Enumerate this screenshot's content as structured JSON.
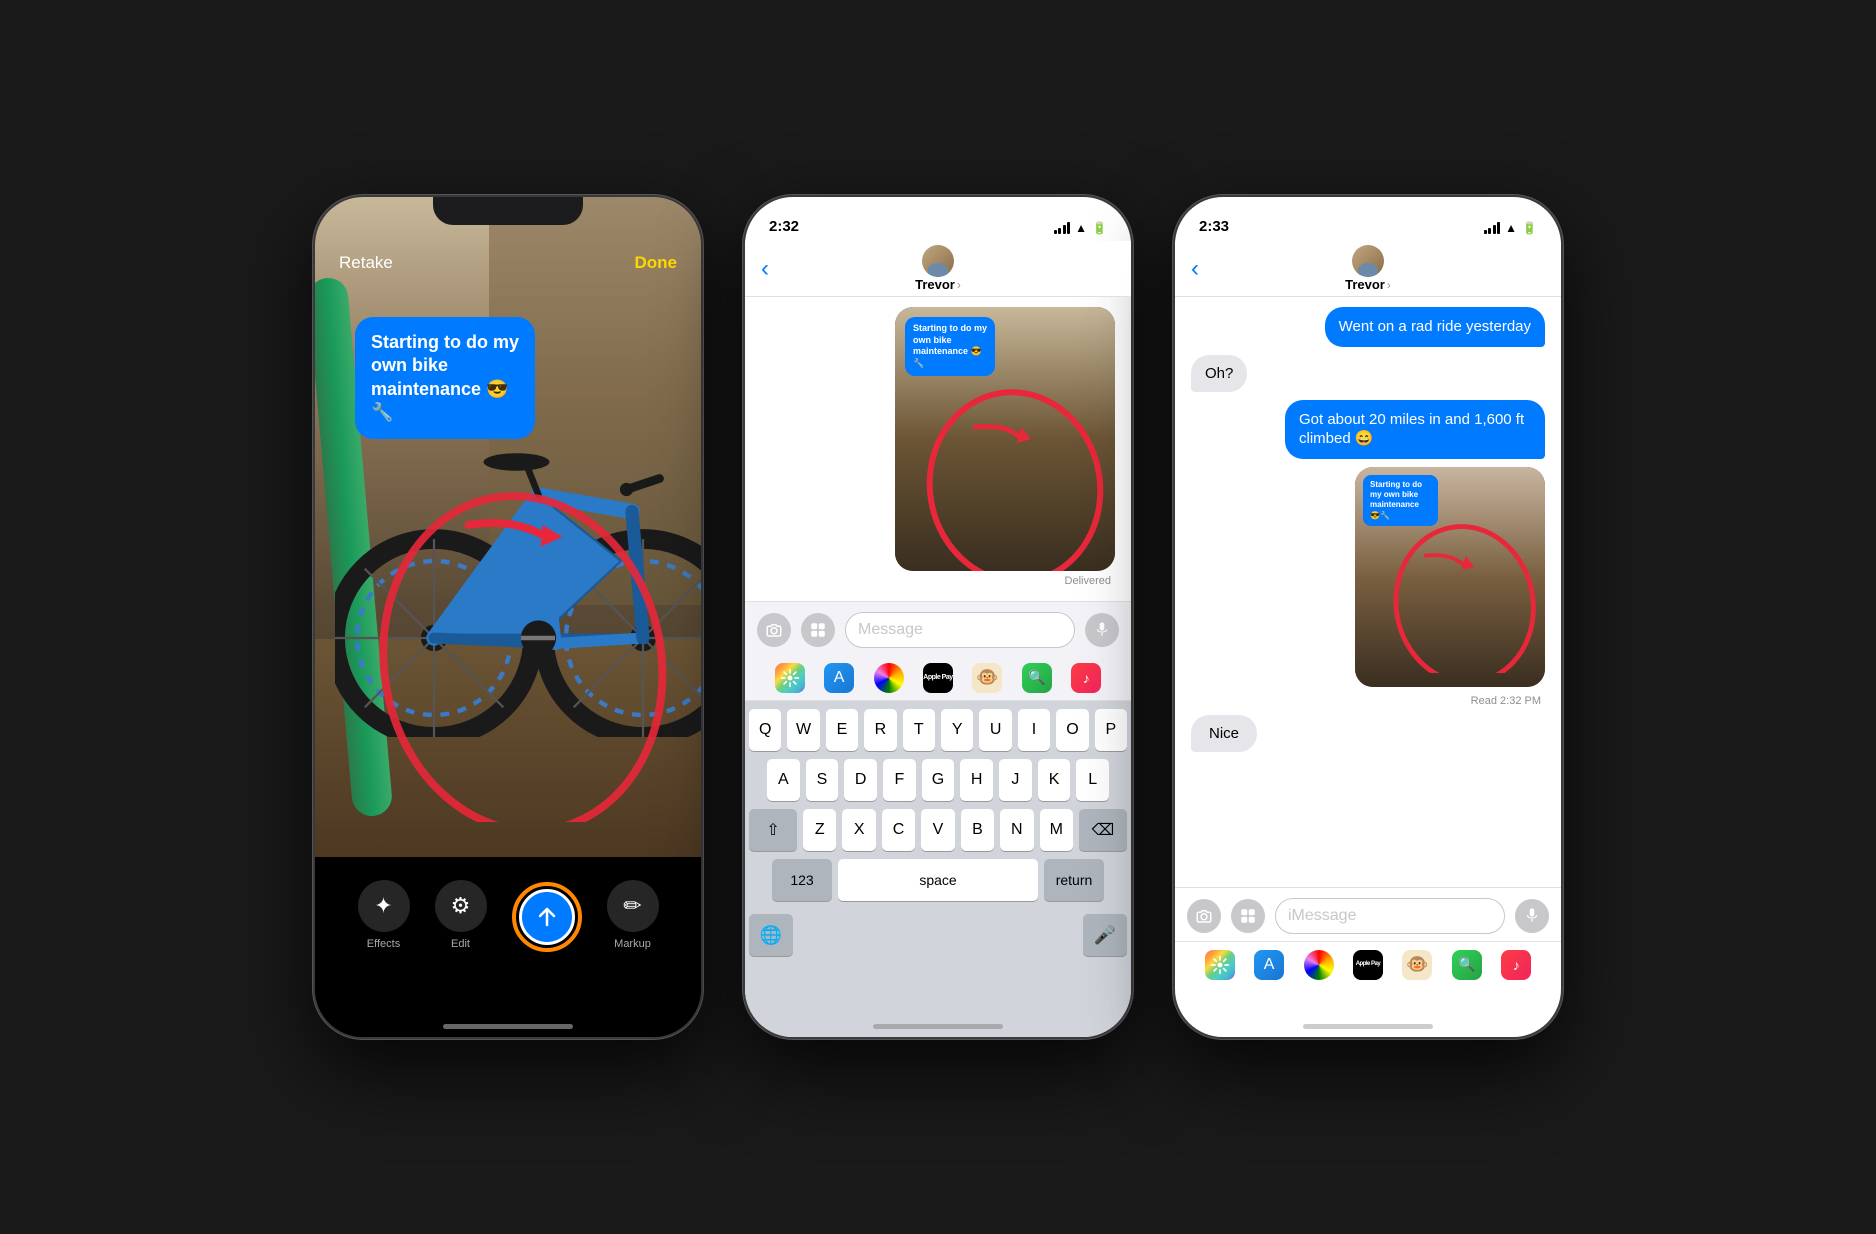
{
  "phones": [
    {
      "id": "phone1",
      "type": "camera_markup",
      "status_bar": {
        "time": "",
        "icons": []
      },
      "top_bar": {
        "left_label": "Retake",
        "right_label": "Done"
      },
      "photo_overlay_text": "Starting to do my own bike maintenance 😎🔧",
      "toolbar_icons": [
        {
          "icon": "✦",
          "label": "Effects"
        },
        {
          "icon": "⚙",
          "label": "Edit"
        },
        {
          "icon": "✏",
          "label": "Markup"
        }
      ]
    },
    {
      "id": "phone2",
      "type": "messages_keyboard",
      "status_bar": {
        "time": "2:32",
        "show_arrow": true
      },
      "contact_name": "Trevor",
      "delivered_label": "Delivered",
      "message_placeholder": "Message",
      "keyboard": {
        "rows": [
          [
            "Q",
            "W",
            "E",
            "R",
            "T",
            "Y",
            "U",
            "I",
            "O",
            "P"
          ],
          [
            "A",
            "S",
            "D",
            "F",
            "G",
            "H",
            "J",
            "K",
            "L"
          ],
          [
            "⇧",
            "Z",
            "X",
            "C",
            "V",
            "B",
            "N",
            "M",
            "⌫"
          ],
          [
            "123",
            "space",
            "return"
          ]
        ]
      }
    },
    {
      "id": "phone3",
      "type": "messages_conversation",
      "status_bar": {
        "time": "2:33",
        "show_arrow": true
      },
      "contact_name": "Trevor",
      "messages": [
        {
          "type": "sent",
          "text": "Went on a rad ride yesterday"
        },
        {
          "type": "received",
          "text": "Oh?"
        },
        {
          "type": "sent",
          "text": "Got about 20 miles in and 1,600 ft climbed 😄"
        },
        {
          "type": "photo_sent",
          "overlay_text": "Starting to do my own bike maintenance 😎🔧"
        },
        {
          "type": "read_label",
          "text": "Read 2:32 PM"
        },
        {
          "type": "received",
          "text": "Nice"
        }
      ],
      "input_placeholder": "iMessage"
    }
  ]
}
